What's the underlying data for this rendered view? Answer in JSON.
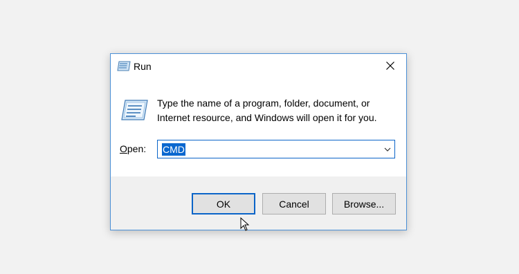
{
  "window": {
    "title": "Run",
    "icon": "run-icon",
    "close_icon": "close-icon",
    "border_color": "#4a8fd6"
  },
  "content": {
    "description_line1": "Type the name of a program, folder, document, or",
    "description_line2": "Internet resource, and Windows will open it for you.",
    "open_label_accel": "O",
    "open_label_rest": "pen:",
    "open_value": "CMD",
    "selection_color": "#0a67cf"
  },
  "buttons": {
    "ok": "OK",
    "cancel": "Cancel",
    "browse": "Browse..."
  }
}
